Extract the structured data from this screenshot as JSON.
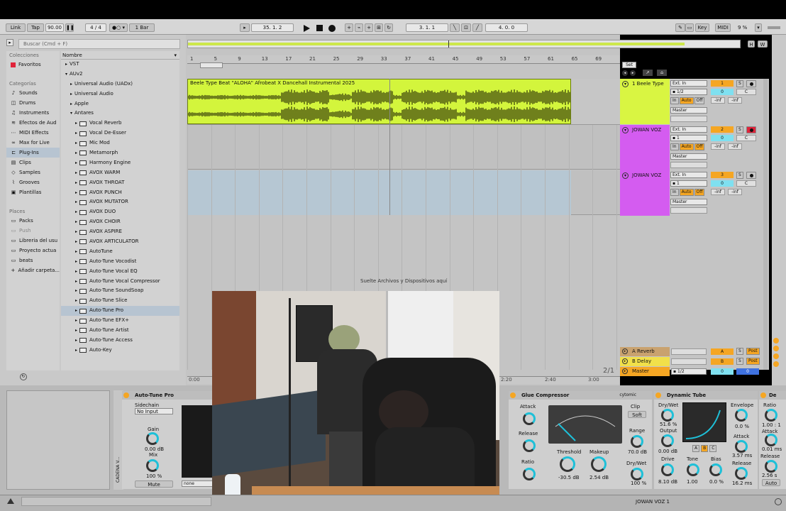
{
  "transport": {
    "link": "Link",
    "tap": "Tap",
    "tempo": "90.00",
    "time_sig": "4 / 4",
    "quantize": "1 Bar",
    "position": "35.  1.  2",
    "loop_start": "3.  1.  1",
    "loop_length": "4.  0.  0",
    "key_label": "Key",
    "midi_label": "MIDI",
    "cpu": "9 %"
  },
  "browser": {
    "search_placeholder": "Buscar (Cmd + F)",
    "collections_header": "Colecciones",
    "favorites": "Favoritos",
    "categories_header": "Categorías",
    "categories": [
      "Sounds",
      "Drums",
      "Instruments",
      "Efectos de Aud",
      "MIDI Effects",
      "Max for Live",
      "Plug-Ins",
      "Clips",
      "Samples",
      "Grooves",
      "Plantillas"
    ],
    "category_icons": [
      "sound-icon",
      "drum-icon",
      "instrument-icon",
      "audio-effect-icon",
      "midi-effect-icon",
      "max-icon",
      "plugin-icon",
      "clip-icon",
      "sample-icon",
      "groove-icon",
      "template-icon"
    ],
    "places_header": "Places",
    "places": [
      "Packs",
      "Push",
      "Libreria del usu",
      "Proyecto actua",
      "beats",
      "Añadir carpeta..."
    ],
    "name_header": "Nombre",
    "tree": [
      {
        "label": "VST",
        "depth": 1,
        "icon": false
      },
      {
        "label": "AUv2",
        "depth": 1,
        "icon": false,
        "open": true
      },
      {
        "label": "Universal Audio (UADx)",
        "depth": 2,
        "icon": false
      },
      {
        "label": "Universal Audio",
        "depth": 2,
        "icon": false
      },
      {
        "label": "Apple",
        "depth": 2,
        "icon": false
      },
      {
        "label": "Antares",
        "depth": 2,
        "icon": false,
        "open": true
      },
      {
        "label": "Vocal Reverb",
        "depth": 3,
        "icon": true
      },
      {
        "label": "Vocal De-Esser",
        "depth": 3,
        "icon": true
      },
      {
        "label": "Mic Mod",
        "depth": 3,
        "icon": true
      },
      {
        "label": "Metamorph",
        "depth": 3,
        "icon": true
      },
      {
        "label": "Harmony Engine",
        "depth": 3,
        "icon": true
      },
      {
        "label": "AVOX WARM",
        "depth": 3,
        "icon": true
      },
      {
        "label": "AVOX THROAT",
        "depth": 3,
        "icon": true
      },
      {
        "label": "AVOX PUNCH",
        "depth": 3,
        "icon": true
      },
      {
        "label": "AVOX MUTATOR",
        "depth": 3,
        "icon": true
      },
      {
        "label": "AVOX DUO",
        "depth": 3,
        "icon": true
      },
      {
        "label": "AVOX CHOIR",
        "depth": 3,
        "icon": true
      },
      {
        "label": "AVOX ASPIRE",
        "depth": 3,
        "icon": true
      },
      {
        "label": "AVOX ARTICULATOR",
        "depth": 3,
        "icon": true
      },
      {
        "label": "AutoTune",
        "depth": 3,
        "icon": true
      },
      {
        "label": "Auto-Tune Vocodist",
        "depth": 3,
        "icon": true
      },
      {
        "label": "Auto-Tune Vocal EQ",
        "depth": 3,
        "icon": true
      },
      {
        "label": "Auto-Tune Vocal Compressor",
        "depth": 3,
        "icon": true
      },
      {
        "label": "Auto-Tune SoundSoap",
        "depth": 3,
        "icon": true
      },
      {
        "label": "Auto-Tune Slice",
        "depth": 3,
        "icon": true
      },
      {
        "label": "Auto-Tune Pro",
        "depth": 3,
        "icon": true,
        "selected": true
      },
      {
        "label": "Auto-Tune EFX+",
        "depth": 3,
        "icon": true
      },
      {
        "label": "Auto-Tune Artist",
        "depth": 3,
        "icon": true
      },
      {
        "label": "Auto-Tune Access",
        "depth": 3,
        "icon": true
      },
      {
        "label": "Auto-Key",
        "depth": 3,
        "icon": true
      }
    ]
  },
  "arrangement": {
    "ruler": [
      "1",
      "5",
      "9",
      "13",
      "17",
      "21",
      "25",
      "29",
      "33",
      "37",
      "41",
      "45",
      "49",
      "53",
      "57",
      "61",
      "65",
      "69"
    ],
    "time_ruler": [
      "0:00",
      "2:20",
      "2:40",
      "3:00"
    ],
    "page": "2/1",
    "drop_hint": "Suelte Archivos y Dispositivos aquí",
    "clip_name": "Beele Type Beat \"ALOHA\" Afrobeat X Dancehall Instrumental 2025",
    "set_label": "Set"
  },
  "tracks": [
    {
      "name": "1 Beele Type",
      "color": "#d9f542",
      "input": "Ext. In",
      "channel": "1/2",
      "num": "1",
      "num_color": "#f5a623",
      "pan": "0",
      "pan2": "C",
      "out": "Master",
      "vol": "-inf",
      "vol2": "-inf",
      "arm": false
    },
    {
      "name": "JOWAN VOZ",
      "color": "#d45cf0",
      "input": "Ext. In",
      "channel": "1",
      "num": "2",
      "num_color": "#f5a623",
      "pan": "0",
      "pan2": "C",
      "out": "Master",
      "vol": "-inf",
      "vol2": "-inf",
      "arm": true
    },
    {
      "name": "JOWAN VOZ",
      "color": "#d45cf0",
      "input": "Ext. In",
      "channel": "1",
      "num": "3",
      "num_color": "#f5a623",
      "pan": "0",
      "pan2": "C",
      "out": "Master",
      "vol": "-inf",
      "vol2": "-inf",
      "arm": false
    }
  ],
  "monitor_in": "In",
  "monitor_auto": "Auto",
  "monitor_off": "Off",
  "solo": "S",
  "returns": [
    {
      "name": "A Reverb",
      "letter": "A",
      "post": "Post"
    },
    {
      "name": "B Delay",
      "letter": "B",
      "post": "Post"
    }
  ],
  "master": {
    "name": "Master",
    "channel": "1/2",
    "pan": "0",
    "vol": "0"
  },
  "devices": {
    "chain_label": "CADENA V...",
    "autotune": {
      "title": "Auto-Tune Pro",
      "sidechain": "Sidechain",
      "input": "No Input",
      "gain_label": "Gain",
      "gain": "0.00 dB",
      "mix_label": "Mix",
      "mix": "100 %",
      "mute": "Mute",
      "none": "none"
    },
    "glue": {
      "title": "Glue Compressor",
      "attack": "Attack",
      "release": "Release",
      "ratio": "Ratio",
      "threshold": "Threshold",
      "threshold_val": "-30.5 dB",
      "makeup": "Makeup",
      "makeup_val": "2.54 dB",
      "clip": "Clip",
      "soft": "Soft",
      "range": "Range",
      "range_val": "70.0 dB",
      "drywet": "Dry/Wet",
      "drywet_val": "100 %",
      "brand": "cytomic"
    },
    "tube": {
      "title": "Dynamic Tube",
      "drywet": "Dry/Wet",
      "drywet_val": "51.6 %",
      "output": "Output",
      "output_val": "0.00 dB",
      "drive": "Drive",
      "drive_val": "8.10 dB",
      "tone": "Tone",
      "tone_val": "1.00",
      "bias": "Bias",
      "bias_val": "0.0 %",
      "envelope": "Envelope",
      "envelope_val": "0.0 %",
      "attack": "Attack",
      "attack_val": "3.57 ms",
      "release": "Release",
      "release_val": "16.2 ms",
      "abc": [
        "A",
        "B",
        "C"
      ]
    },
    "next": {
      "title": "De",
      "ratio": "Ratio",
      "attack": "Attack",
      "attack_val": "0.01 ms",
      "release": "Release",
      "release_val": "2.56 s",
      "ratio_val": "1.00 : 1",
      "auto": "Auto"
    }
  },
  "status": {
    "track": "JOWAN VOZ 1"
  }
}
